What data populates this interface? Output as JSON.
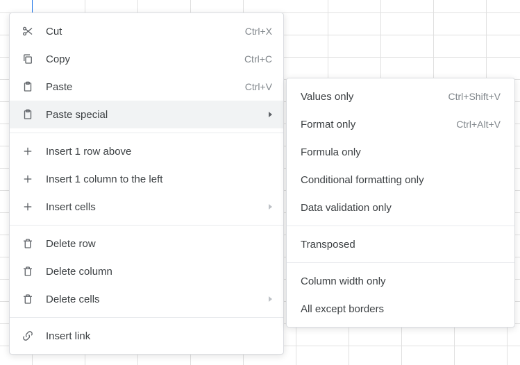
{
  "main_menu": {
    "cut": {
      "label": "Cut",
      "shortcut": "Ctrl+X"
    },
    "copy": {
      "label": "Copy",
      "shortcut": "Ctrl+C"
    },
    "paste": {
      "label": "Paste",
      "shortcut": "Ctrl+V"
    },
    "paste_special": {
      "label": "Paste special"
    },
    "insert_row_above": {
      "label": "Insert 1 row above"
    },
    "insert_col_left": {
      "label": "Insert 1 column to the left"
    },
    "insert_cells": {
      "label": "Insert cells"
    },
    "delete_row": {
      "label": "Delete row"
    },
    "delete_column": {
      "label": "Delete column"
    },
    "delete_cells": {
      "label": "Delete cells"
    },
    "insert_link": {
      "label": "Insert link"
    }
  },
  "submenu": {
    "values_only": {
      "label": "Values only",
      "shortcut": "Ctrl+Shift+V"
    },
    "format_only": {
      "label": "Format only",
      "shortcut": "Ctrl+Alt+V"
    },
    "formula_only": {
      "label": "Formula only"
    },
    "cond_fmt": {
      "label": "Conditional formatting only"
    },
    "data_valid": {
      "label": "Data validation only"
    },
    "transposed": {
      "label": "Transposed"
    },
    "col_width": {
      "label": "Column width only"
    },
    "all_except_borders": {
      "label": "All except borders"
    }
  }
}
